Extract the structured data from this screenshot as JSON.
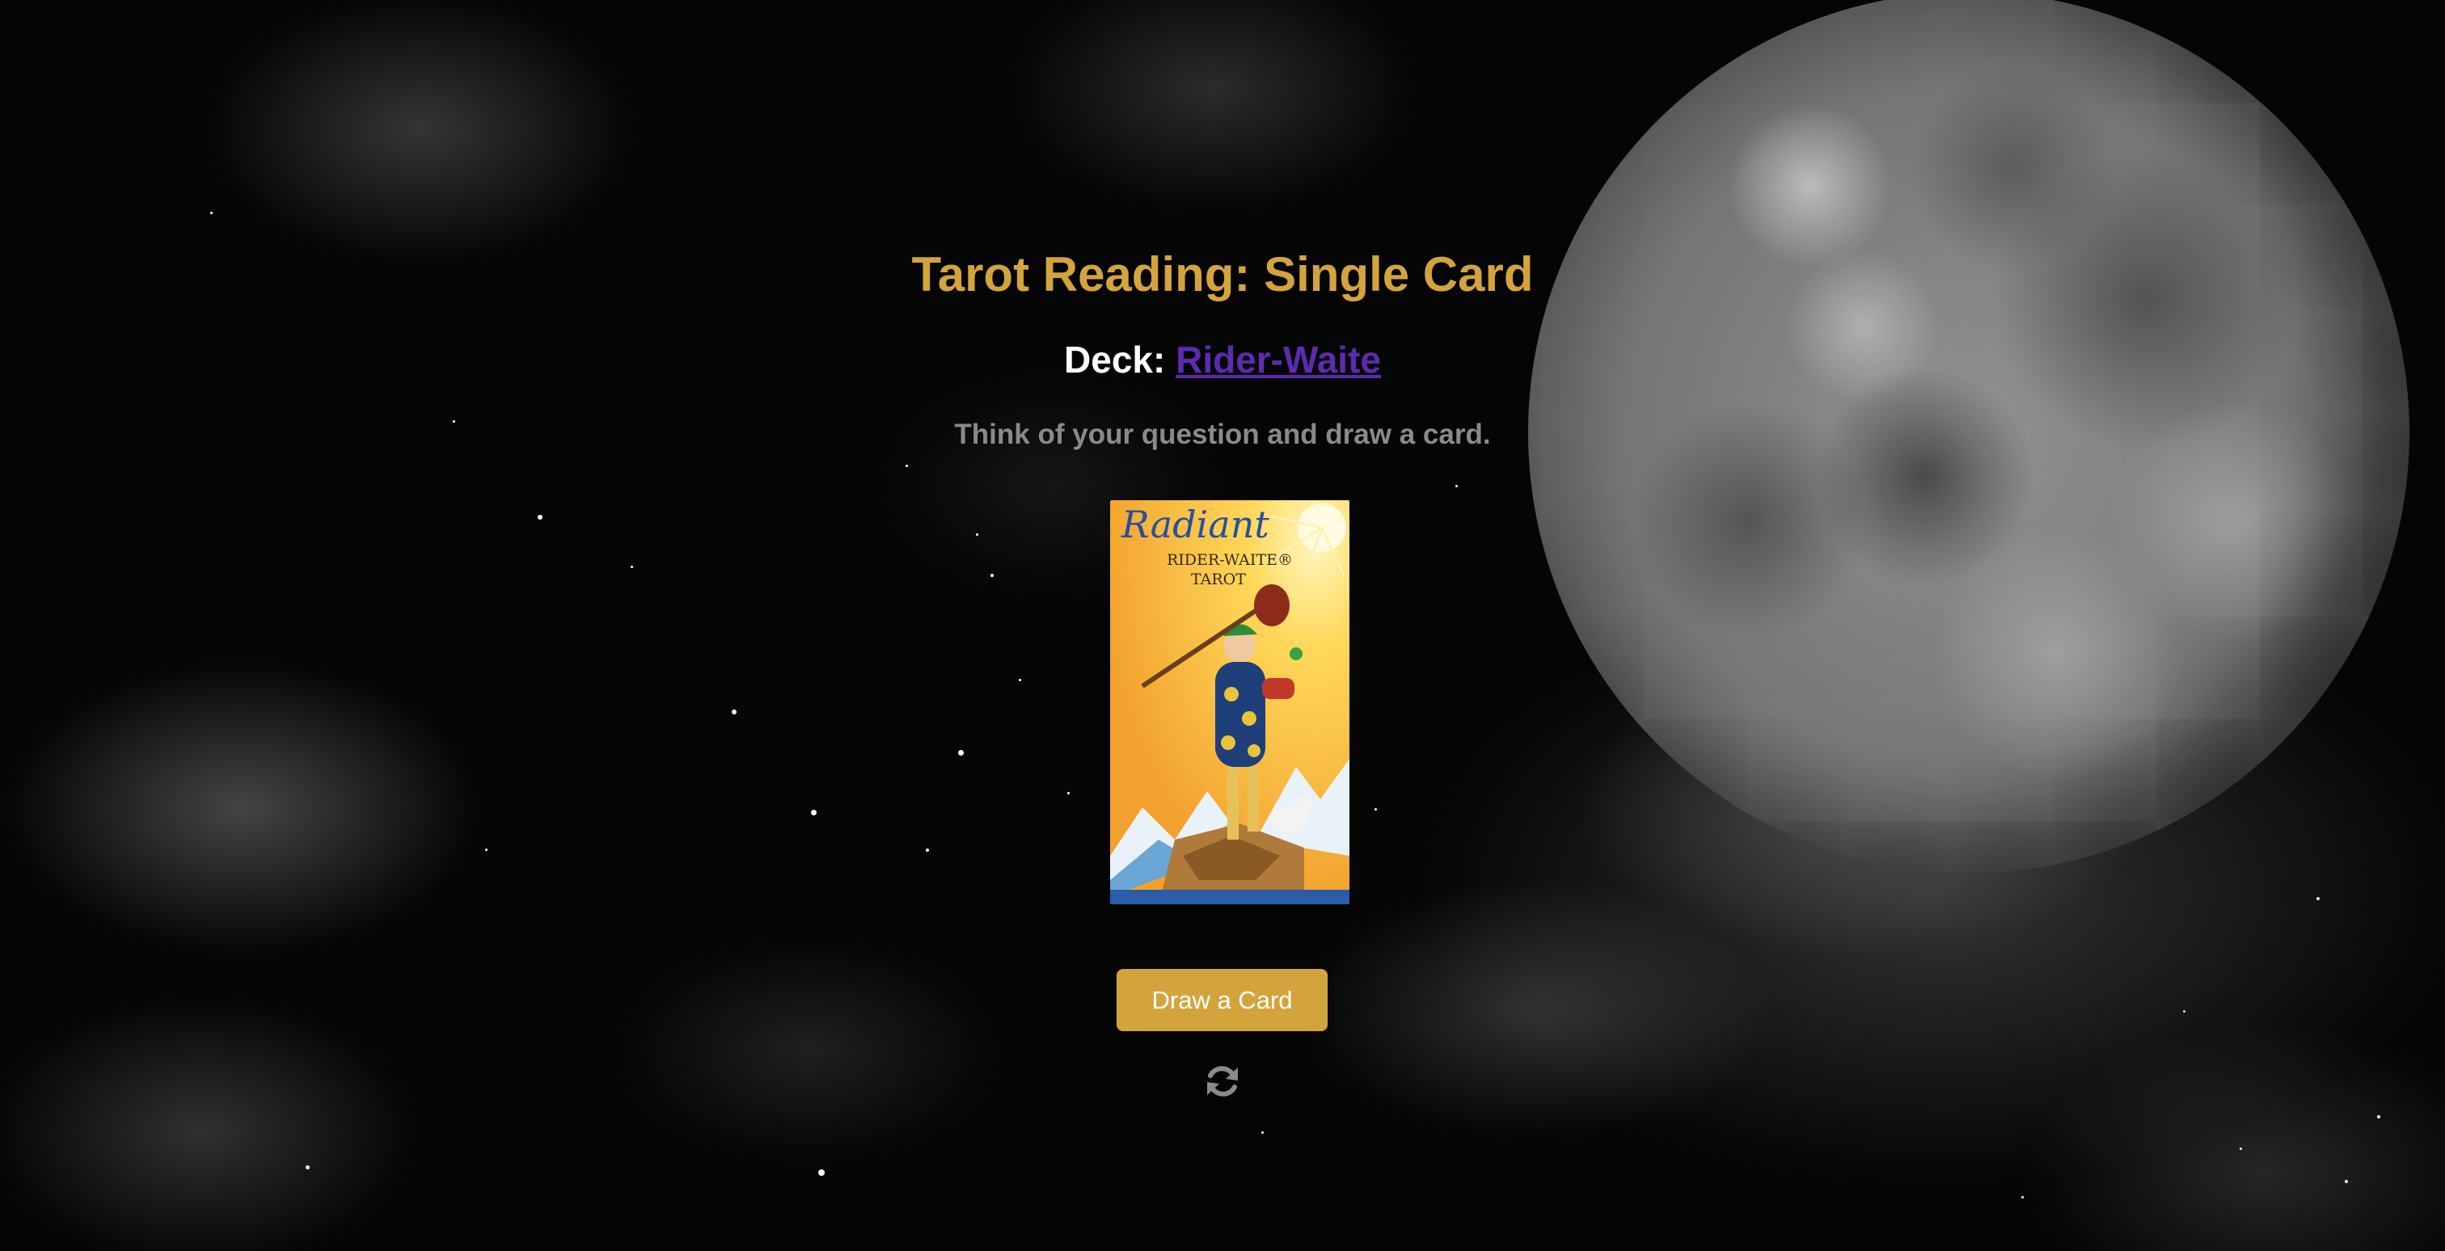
{
  "theme": {
    "gold": "#d4a43c",
    "link": "#5b2bb0",
    "prompt_gray": "#8a8a8a",
    "background": "#000000"
  },
  "header": {
    "title": "Tarot Reading: Single Card"
  },
  "deck": {
    "label": "Deck:",
    "name": "Rider-Waite"
  },
  "instructions": {
    "text": "Think of your question and draw a card."
  },
  "card_back": {
    "title_script": "Radiant",
    "title_line_1": "RIDER-WAITE®",
    "title_line_2": "TAROT"
  },
  "actions": {
    "draw_label": "Draw a Card",
    "refresh_icon": "refresh-icon"
  }
}
